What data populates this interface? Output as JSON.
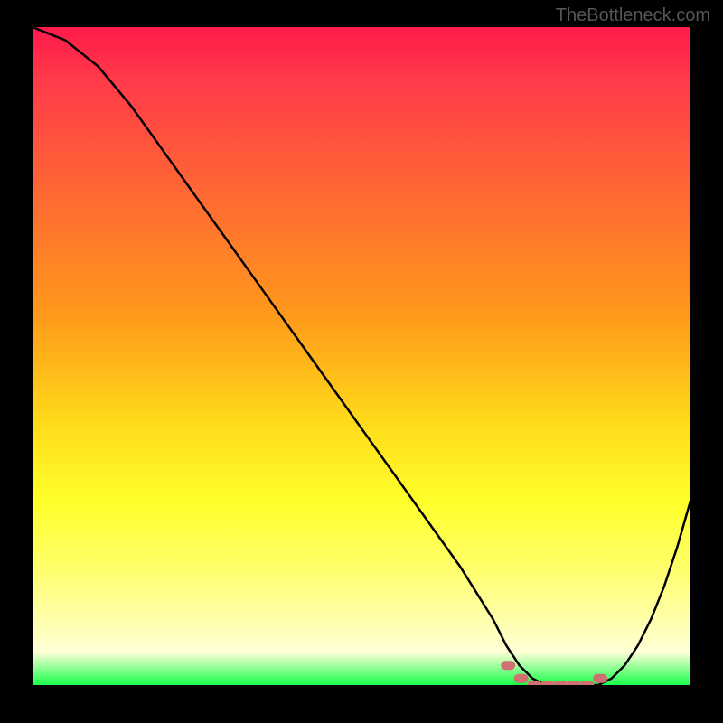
{
  "watermark": "TheBottleneck.com",
  "chart_data": {
    "type": "line",
    "title": "",
    "xlabel": "",
    "ylabel": "",
    "xlim": [
      0,
      100
    ],
    "ylim": [
      0,
      100
    ],
    "x": [
      0,
      5,
      10,
      15,
      20,
      25,
      30,
      35,
      40,
      45,
      50,
      55,
      60,
      65,
      70,
      72,
      74,
      76,
      78,
      80,
      82,
      84,
      86,
      88,
      90,
      92,
      94,
      96,
      98,
      100
    ],
    "values": [
      100,
      98,
      94,
      88,
      81,
      74,
      67,
      60,
      53,
      46,
      39,
      32,
      25,
      18,
      10,
      6,
      3,
      1,
      0,
      0,
      0,
      0,
      0,
      1,
      3,
      6,
      10,
      15,
      21,
      28
    ],
    "markers": {
      "x": [
        72,
        74,
        76,
        78,
        80,
        82,
        84,
        86
      ],
      "y": [
        3,
        1,
        0,
        0,
        0,
        0,
        0,
        1
      ],
      "color": "#d07070"
    },
    "gradient_colors": [
      "#ff1a4a",
      "#ff7a2a",
      "#ffff2a",
      "#18ff4a"
    ]
  }
}
